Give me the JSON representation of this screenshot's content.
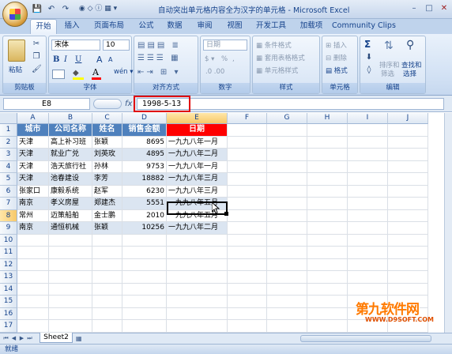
{
  "window": {
    "title": "自动突出单元格内容全为汉字的单元格 - Microsoft Excel",
    "minimize": "–",
    "maximize": "□",
    "close": "✕",
    "quick_access": [
      "💾",
      "↶",
      "↷",
      "▾"
    ]
  },
  "tabs": [
    "开始",
    "插入",
    "页面布局",
    "公式",
    "数据",
    "审阅",
    "视图",
    "开发工具",
    "加载项",
    "Community Clips"
  ],
  "ribbon": {
    "clipboard": {
      "paste": "粘贴",
      "label": "剪贴板"
    },
    "font": {
      "name": "宋体",
      "size": "10",
      "bold": "B",
      "italic": "I",
      "underline": "U",
      "grow": "A",
      "shrink": "A",
      "label": "字体"
    },
    "align": {
      "label": "对齐方式"
    },
    "number": {
      "format": "日期",
      "percent": "%",
      "comma": ",",
      "label": "数字"
    },
    "styles": {
      "cond": "条件格式",
      "table": "套用表格格式",
      "cell": "单元格样式",
      "label": "样式"
    },
    "cells": {
      "insert": "插入",
      "delete": "删除",
      "format": "格式",
      "label": "单元格"
    },
    "editing": {
      "sum": "Σ",
      "sort": "排序和",
      "sort2": "筛选",
      "find": "查找和",
      "find2": "选择",
      "label": "编辑"
    }
  },
  "formula_bar": {
    "name_box": "E8",
    "fx": "fx",
    "value": "1998-5-13"
  },
  "columns": [
    "A",
    "B",
    "C",
    "D",
    "E",
    "F",
    "G",
    "H",
    "I",
    "J"
  ],
  "rows": [
    "1",
    "2",
    "3",
    "4",
    "5",
    "6",
    "7",
    "8",
    "9",
    "10",
    "11",
    "12",
    "13",
    "14",
    "15",
    "16",
    "17"
  ],
  "table": {
    "headers": [
      "城市",
      "公司名称",
      "姓名",
      "销售金额",
      "日期"
    ],
    "rows": [
      [
        "天津",
        "高上补习班",
        "张颖",
        "8695",
        "一九九八年一月"
      ],
      [
        "天津",
        "就业广兑",
        "刘英玫",
        "4895",
        "一九九八年二月"
      ],
      [
        "天津",
        "浩天旅行社",
        "孙林",
        "9753",
        "一九九八年一月"
      ],
      [
        "天津",
        "池春建设",
        "李芳",
        "18882",
        "一九九八年三月"
      ],
      [
        "张家口",
        "康毅系统",
        "赵军",
        "6230",
        "一九九八年三月"
      ],
      [
        "南京",
        "孝义房屋",
        "郑建杰",
        "5551",
        "一九九八年五月"
      ],
      [
        "常州",
        "迈策船舶",
        "金士鹏",
        "2010",
        "一九九八年五月"
      ],
      [
        "南京",
        "通恒机械",
        "张颖",
        "10256",
        "一九九八年二月"
      ]
    ]
  },
  "sheet_tab": "Sheet2",
  "status": "就绪",
  "watermark": {
    "line1": "第九软件网",
    "line2": "WWW.D9SOFT.COM"
  },
  "colors": {
    "header_blue": "#4f81bd",
    "date_header_red": "#ff0000",
    "band": "#dbe5f1",
    "highlight": "#e00000"
  }
}
